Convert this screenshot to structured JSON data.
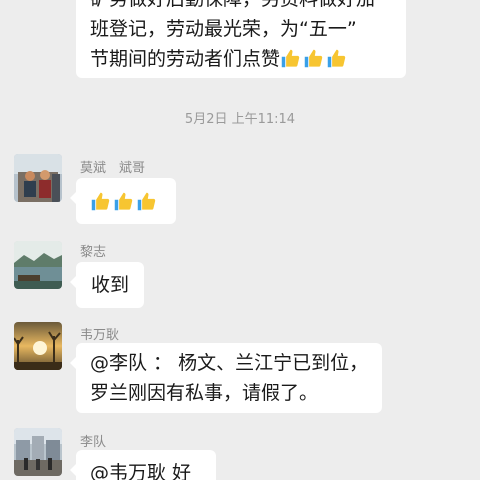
{
  "messages": {
    "top_text": "矿务做好后勤保障，另资料做好加班登记，劳动最光荣，为“五一”节期间的劳动者们点赞",
    "timestamp": "5月2日 上午11:14",
    "items": [
      {
        "sender": "莫斌　斌哥",
        "thumbs": 3
      },
      {
        "sender": "黎志",
        "text": "收到"
      },
      {
        "sender": "韦万耿",
        "text": "@李队 ： 杨文、兰江宁已到位，罗兰刚因有私事，请假了。"
      },
      {
        "sender": "李队",
        "text": "@韦万耿  好"
      }
    ]
  },
  "top_bubble": {
    "line1": "矿务做好后勤保障，另资料做好加",
    "line2": "班登记，劳动最光荣，为“五一”",
    "line3": "节期间的劳动者们点赞"
  },
  "msg1": {
    "sender": "莫斌　斌哥"
  },
  "msg2": {
    "sender": "黎志",
    "text": "收到"
  },
  "msg3": {
    "sender": "韦万耿",
    "line1": "@李队 ： 杨文、兰江宁已到位，",
    "line2": "罗兰刚因有私事，请假了。"
  },
  "msg4": {
    "sender": "李队",
    "text": "@韦万耿  好"
  },
  "icons": {
    "thumbs": "thumbs-up-emoji"
  },
  "colors": {
    "background": "#ededed",
    "bubble": "#ffffff",
    "thumb": "#f7c531"
  }
}
